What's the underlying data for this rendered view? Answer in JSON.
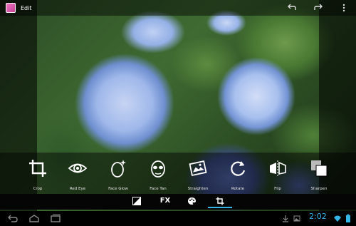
{
  "app": {
    "title": "Edit"
  },
  "tools": [
    {
      "label": "Crop",
      "icon": "crop-icon"
    },
    {
      "label": "Red Eye",
      "icon": "eye-icon"
    },
    {
      "label": "Face Glow",
      "icon": "face-glow-icon"
    },
    {
      "label": "Face Tan",
      "icon": "face-tan-icon"
    },
    {
      "label": "Straighten",
      "icon": "straighten-icon"
    },
    {
      "label": "Rotate",
      "icon": "rotate-icon"
    },
    {
      "label": "Flip",
      "icon": "flip-icon"
    },
    {
      "label": "Sharpen",
      "icon": "sharpen-icon"
    }
  ],
  "categories": {
    "fx_label": "FX",
    "selected": "crop-category"
  },
  "status": {
    "time": "2:02",
    "accent": "#33b5e5"
  }
}
